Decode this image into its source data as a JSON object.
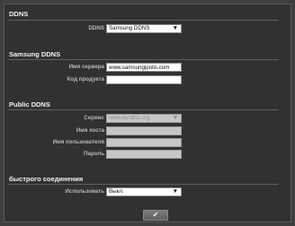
{
  "ddns": {
    "title": "DDNS",
    "ddns_label": "DDNS",
    "ddns_value": "Samsung DDNS"
  },
  "samsung_ddns": {
    "title": "Samsung DDNS",
    "server_label": "Имя сервера",
    "server_value": "www.samsungipolis.com",
    "product_code_label": "Код продукта",
    "product_code_value": ""
  },
  "public_ddns": {
    "title": "Public DDNS",
    "service_label": "Сервис",
    "service_value": "www.dyndns.org",
    "host_label": "Имя хоста",
    "host_value": "",
    "username_label": "Имя пользователя",
    "username_value": "",
    "password_label": "Пароль",
    "password_value": ""
  },
  "quick_connect": {
    "title": "быстрого соединения",
    "use_label": "Использовать",
    "use_value": "Выкл."
  },
  "footer": {
    "ok_icon": "checkmark-icon",
    "ok_glyph": "✔"
  }
}
